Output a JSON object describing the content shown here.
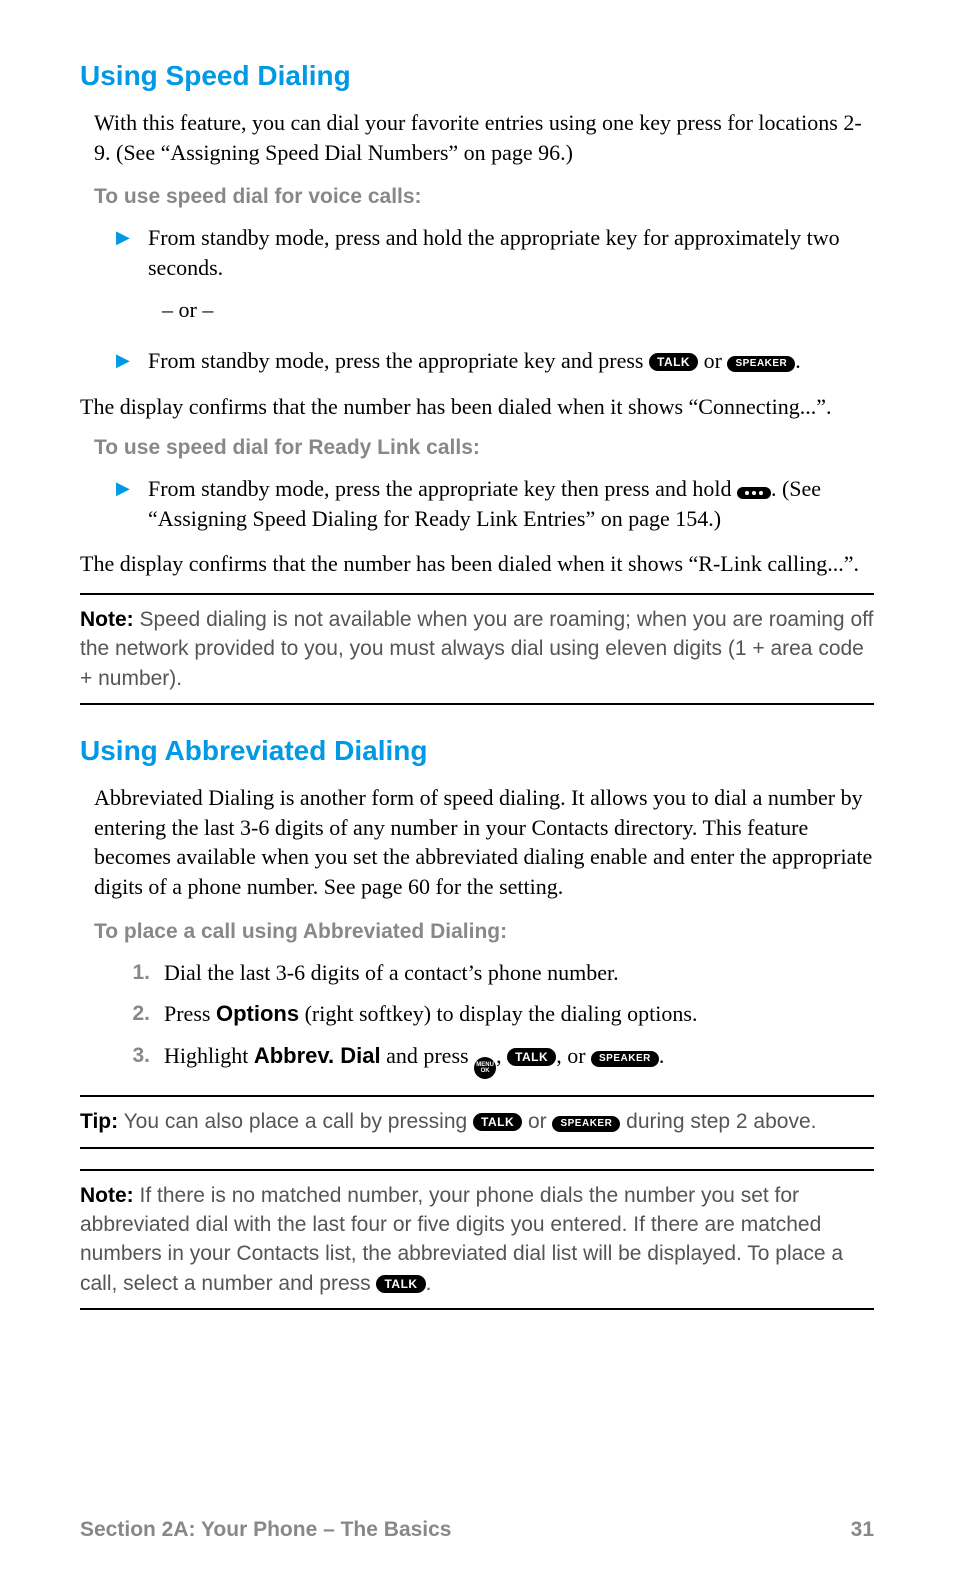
{
  "section1": {
    "title": "Using Speed Dialing",
    "intro": "With this feature, you can dial your favorite entries using one key press for locations 2-9. (See “Assigning Speed Dial Numbers” on page 96.)",
    "voice_label": "To use speed dial for voice calls:",
    "bullet1": "From standby mode, press and hold the appropriate key for approximately two seconds.",
    "or": "– or –",
    "bullet2a": "From standby mode, press the appropriate key and press ",
    "bullet2b": " or ",
    "bullet2c": ".",
    "confirm1": "The display confirms that the number has been dialed when it shows “Connecting...”.",
    "ready_label": "To use speed dial for Ready Link calls:",
    "bullet3a": "From standby mode, press the appropriate key then press and hold ",
    "bullet3b": ". (See “Assigning Speed Dialing for Ready Link Entries” on page 154.)",
    "confirm2": "The display confirms that the number has been dialed when it shows “R-Link calling...”.",
    "note_lead": "Note:",
    "note_body": " Speed dialing is not available when you are roaming; when you are roaming off the network provided to you, you must always dial using eleven digits (1 + area code + number)."
  },
  "section2": {
    "title": "Using Abbreviated Dialing",
    "intro": "Abbreviated Dialing is another form of speed dialing. It allows you to dial a number by entering the last 3-6 digits of any number in your Contacts directory. This feature becomes available when you set the abbreviated dialing enable and enter the appropriate digits of a phone number. See page 60 for the setting.",
    "sub_label": "To place a call using Abbreviated Dialing:",
    "step1": "Dial the last 3-6 digits of a contact’s phone number.",
    "step2a": "Press ",
    "step2_opt": "Options",
    "step2b": " (right softkey) to display the dialing options.",
    "step3a": "Highlight ",
    "step3_opt": "Abbrev. Dial",
    "step3b": " and press ",
    "step3c": ", ",
    "step3d": ", or ",
    "step3e": ".",
    "tip_lead": "Tip:",
    "tip_a": " You can also place a call by pressing ",
    "tip_b": " or ",
    "tip_c": " during step 2 above.",
    "note2_lead": "Note:",
    "note2_a": " If there is no matched number, your phone dials the number you set for abbreviated dial with the last four or five digits you entered. If there are matched numbers in your Contacts list, the abbreviated dial list will be displayed. To place a call, select a number and press ",
    "note2_b": "."
  },
  "buttons": {
    "talk": "TALK",
    "speaker": "SPEAKER",
    "menu1": "MENU",
    "menu2": "OK"
  },
  "footer": {
    "left": "Section 2A: Your Phone – The Basics",
    "right": "31"
  },
  "nums": {
    "n1": "1.",
    "n2": "2.",
    "n3": "3."
  },
  "glyphs": {
    "tri": "▶"
  }
}
